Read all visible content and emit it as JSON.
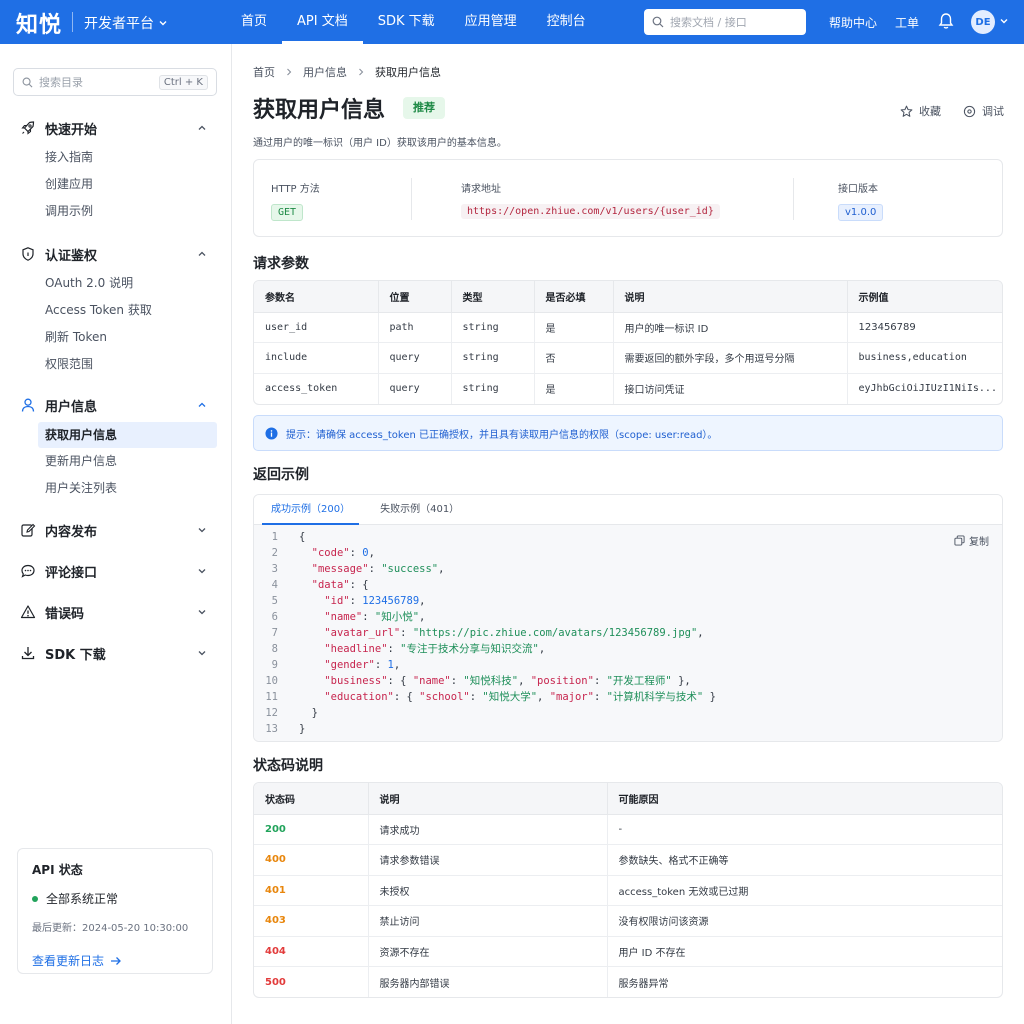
{
  "header": {
    "logo": "知悦",
    "platform": "开发者平台",
    "nav": [
      "首页",
      "API 文档",
      "SDK 下载",
      "应用管理",
      "控制台"
    ],
    "active_nav": 1,
    "search_placeholder": "搜索文档 / 接口",
    "help": "帮助中心",
    "ticket": "工单",
    "avatar": "DE"
  },
  "sidebar": {
    "search_placeholder": "搜索目录",
    "shortcut": "Ctrl + K",
    "groups": [
      {
        "title": "快速开始",
        "items": [
          "接入指南",
          "创建应用",
          "调用示例"
        ]
      },
      {
        "title": "认证鉴权",
        "items": [
          "OAuth 2.0 说明",
          "Access Token 获取",
          "刷新 Token",
          "权限范围"
        ]
      },
      {
        "title": "用户信息",
        "items": [
          "获取用户信息",
          "更新用户信息",
          "用户关注列表"
        ]
      },
      {
        "title": "内容发布",
        "items": []
      },
      {
        "title": "评论接口",
        "items": []
      },
      {
        "title": "错误码",
        "items": []
      },
      {
        "title": "SDK 下载",
        "items": []
      }
    ],
    "status": {
      "title": "API 状态",
      "state": "全部系统正常",
      "updated": "最后更新：2024-05-20 10:30:00",
      "link": "查看更新日志"
    }
  },
  "main": {
    "breadcrumb": [
      "首页",
      "用户信息",
      "获取用户信息"
    ],
    "title": "获取用户信息",
    "tag": "推荐",
    "favorite": "收藏",
    "debug": "调试",
    "description": "通过用户的唯一标识（用户 ID）获取该用户的基本信息。",
    "info": {
      "method_label": "HTTP 方法",
      "method": "GET",
      "url_label": "请求地址",
      "url": "https://open.zhiue.com/v1/users/{user_id}",
      "version_label": "接口版本",
      "version": "v1.0.0"
    },
    "params_title": "请求参数",
    "params_headers": [
      "参数名",
      "位置",
      "类型",
      "是否必填",
      "说明",
      "示例值"
    ],
    "params": [
      [
        "user_id",
        "path",
        "string",
        "是",
        "用户的唯一标识 ID",
        "123456789"
      ],
      [
        "include",
        "query",
        "string",
        "否",
        "需要返回的额外字段，多个用逗号分隔",
        "business,education"
      ],
      [
        "access_token",
        "query",
        "string",
        "是",
        "接口访问凭证",
        "eyJhbGciOiJIUzI1NiIs..."
      ]
    ],
    "tip": "提示：请确保 access_token 已正确授权，并且具有读取用户信息的权限（scope: user:read）。",
    "response_title": "返回示例",
    "response_tabs": [
      "成功示例（200）",
      "失败示例（401）"
    ],
    "copy": "复制",
    "code_lines": [
      "{",
      "  \"code\": 0,",
      "  \"message\": \"success\",",
      "  \"data\": {",
      "    \"id\": 123456789,",
      "    \"name\": \"知小悦\",",
      "    \"avatar_url\": \"https://pic.zhiue.com/avatars/123456789.jpg\",",
      "    \"headline\": \"专注于技术分享与知识交流\",",
      "    \"gender\": 1,",
      "    \"business\": { \"name\": \"知悦科技\", \"position\": \"开发工程师\" },",
      "    \"education\": { \"school\": \"知悦大学\", \"major\": \"计算机科学与技术\" }",
      "  }",
      "}"
    ],
    "status_title": "状态码说明",
    "status_headers": [
      "状态码",
      "说明",
      "可能原因"
    ],
    "status_rows": [
      [
        "200",
        "请求成功",
        "-"
      ],
      [
        "400",
        "请求参数错误",
        "参数缺失、格式不正确等"
      ],
      [
        "401",
        "未授权",
        "access_token 无效或已过期"
      ],
      [
        "403",
        "禁止访问",
        "没有权限访问该资源"
      ],
      [
        "404",
        "资源不存在",
        "用户 ID 不存在"
      ],
      [
        "500",
        "服务器内部错误",
        "服务器异常"
      ]
    ]
  },
  "colors": {
    "brand": "#1f6fe5",
    "success": "#21a35b",
    "warning": "#e8860c",
    "error": "#e23b3b"
  }
}
